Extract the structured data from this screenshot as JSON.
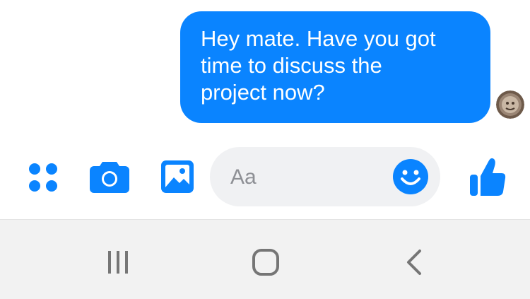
{
  "conversation": {
    "messages": [
      {
        "sender": "me",
        "lines": [
          "Hey mate. Have you got",
          "time to discuss the",
          "project now?"
        ]
      }
    ]
  },
  "composer": {
    "placeholder": "Aa",
    "icons": [
      "menu-dots-icon",
      "camera-icon",
      "image-icon",
      "emoji-icon",
      "thumbs-up-icon"
    ]
  },
  "system_nav": {
    "icons": [
      "recents-icon",
      "home-icon",
      "back-icon"
    ]
  },
  "colors": {
    "accent": "#0a84ff",
    "bubble_text": "#ffffff",
    "input_bg": "#f0f1f3",
    "placeholder": "#8e9095",
    "nav_bg": "#f2f2f2",
    "nav_icon": "#767676"
  }
}
